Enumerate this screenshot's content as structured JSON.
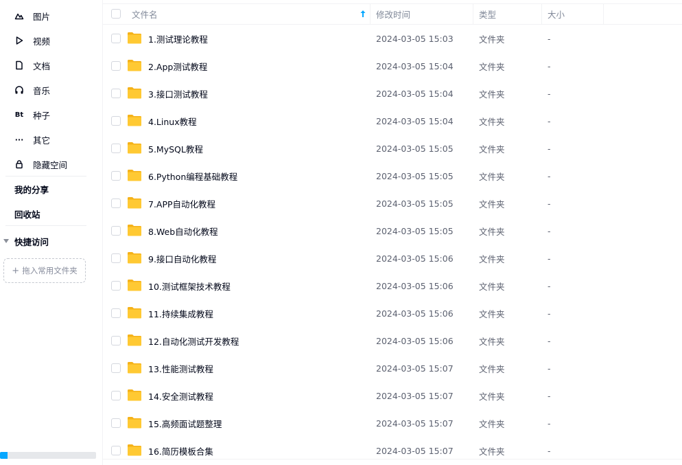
{
  "sidebar": {
    "categories": [
      {
        "label": "图片",
        "icon": "image-icon"
      },
      {
        "label": "视频",
        "icon": "video-icon"
      },
      {
        "label": "文档",
        "icon": "document-icon"
      },
      {
        "label": "音乐",
        "icon": "headphones-icon"
      },
      {
        "label": "种子",
        "icon": "bt-icon",
        "icon_text": "Bt"
      },
      {
        "label": "其它",
        "icon": "more-icon",
        "icon_text": "···"
      },
      {
        "label": "隐藏空间",
        "icon": "lock-icon"
      }
    ],
    "my_share": "我的分享",
    "recycle_bin": "回收站",
    "quick_access": "快捷访问",
    "drop_zone": "拖入常用文件夹",
    "drop_zone_plus": "+",
    "quota_fraction": 0.08
  },
  "table": {
    "headers": {
      "name": "文件名",
      "modified": "修改时间",
      "type": "类型",
      "size": "大小"
    },
    "rows": [
      {
        "name": "1.测试理论教程",
        "modified": "2024-03-05 15:03",
        "type": "文件夹",
        "size": "-"
      },
      {
        "name": "2.App测试教程",
        "modified": "2024-03-05 15:04",
        "type": "文件夹",
        "size": "-"
      },
      {
        "name": "3.接口测试教程",
        "modified": "2024-03-05 15:04",
        "type": "文件夹",
        "size": "-"
      },
      {
        "name": "4.Linux教程",
        "modified": "2024-03-05 15:04",
        "type": "文件夹",
        "size": "-"
      },
      {
        "name": "5.MySQL教程",
        "modified": "2024-03-05 15:05",
        "type": "文件夹",
        "size": "-"
      },
      {
        "name": "6.Python编程基础教程",
        "modified": "2024-03-05 15:05",
        "type": "文件夹",
        "size": "-"
      },
      {
        "name": "7.APP自动化教程",
        "modified": "2024-03-05 15:05",
        "type": "文件夹",
        "size": "-"
      },
      {
        "name": "8.Web自动化教程",
        "modified": "2024-03-05 15:05",
        "type": "文件夹",
        "size": "-"
      },
      {
        "name": "9.接口自动化教程",
        "modified": "2024-03-05 15:06",
        "type": "文件夹",
        "size": "-"
      },
      {
        "name": "10.测试框架技术教程",
        "modified": "2024-03-05 15:06",
        "type": "文件夹",
        "size": "-"
      },
      {
        "name": "11.持续集成教程",
        "modified": "2024-03-05 15:06",
        "type": "文件夹",
        "size": "-"
      },
      {
        "name": "12.自动化测试开发教程",
        "modified": "2024-03-05 15:06",
        "type": "文件夹",
        "size": "-"
      },
      {
        "name": "13.性能测试教程",
        "modified": "2024-03-05 15:07",
        "type": "文件夹",
        "size": "-"
      },
      {
        "name": "14.安全测试教程",
        "modified": "2024-03-05 15:07",
        "type": "文件夹",
        "size": "-"
      },
      {
        "name": "15.高频面试题整理",
        "modified": "2024-03-05 15:07",
        "type": "文件夹",
        "size": "-"
      },
      {
        "name": "16.简历模板合集",
        "modified": "2024-03-05 15:07",
        "type": "文件夹",
        "size": "-"
      }
    ]
  },
  "colors": {
    "accent": "#06a7ff",
    "folder": "#ffc933",
    "folder_tab": "#f5b21a"
  }
}
